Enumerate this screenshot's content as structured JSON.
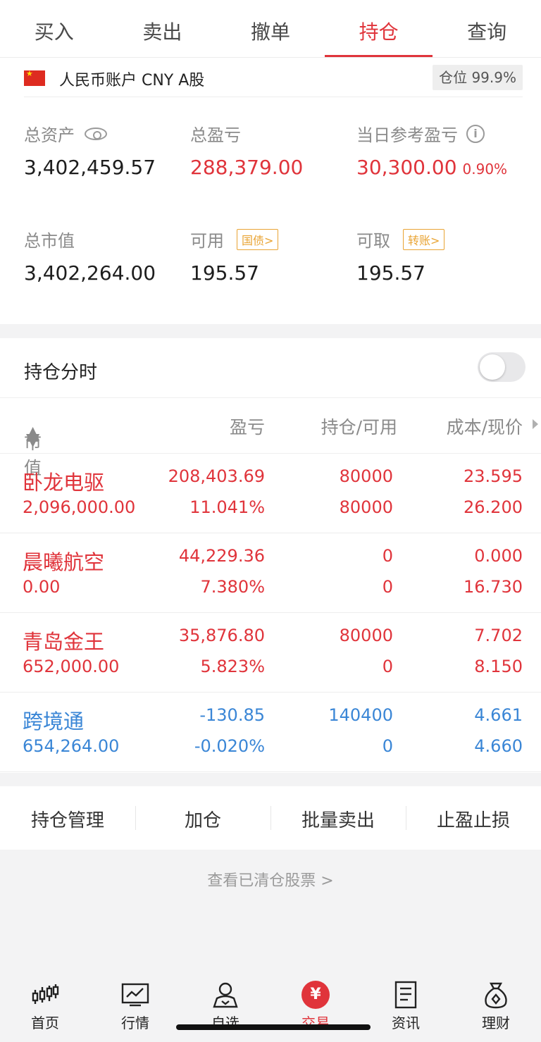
{
  "tabs": [
    "买入",
    "卖出",
    "撤单",
    "持仓",
    "查询"
  ],
  "active_tab": 3,
  "account": {
    "name": "人民币账户 CNY A股",
    "position_ratio": "仓位 99.9%",
    "total_assets_label": "总资产",
    "total_assets": "3,402,459.57",
    "total_pl_label": "总盈亏",
    "total_pl": "288,379.00",
    "day_pl_label": "当日参考盈亏",
    "day_pl": "30,300.00",
    "day_pl_pct": "0.90%",
    "market_value_label": "总市值",
    "market_value": "3,402,264.00",
    "available_label": "可用",
    "available_tag": "国债>",
    "available": "195.57",
    "withdrawable_label": "可取",
    "withdrawable_tag": "转账>",
    "withdrawable": "195.57"
  },
  "holdings": {
    "title": "持仓分时",
    "toggle_on": false,
    "headers": {
      "market_value": "市值",
      "pl": "盈亏",
      "position": "持仓/可用",
      "cost": "成本/现价"
    },
    "rows": [
      {
        "name": "卧龙电驱",
        "market_value": "2,096,000.00",
        "pl": "208,403.69",
        "pl_pct": "11.041%",
        "qty": "80000",
        "available": "80000",
        "cost": "23.595",
        "price": "26.200",
        "color": "#e0343b"
      },
      {
        "name": "晨曦航空",
        "market_value": "0.00",
        "pl": "44,229.36",
        "pl_pct": "7.380%",
        "qty": "0",
        "available": "0",
        "cost": "0.000",
        "price": "16.730",
        "color": "#e0343b"
      },
      {
        "name": "青岛金王",
        "market_value": "652,000.00",
        "pl": "35,876.80",
        "pl_pct": "5.823%",
        "qty": "80000",
        "available": "0",
        "cost": "7.702",
        "price": "8.150",
        "color": "#e0343b"
      },
      {
        "name": "跨境通",
        "market_value": "654,264.00",
        "pl": "-130.85",
        "pl_pct": "-0.020%",
        "qty": "140400",
        "available": "0",
        "cost": "4.661",
        "price": "4.660",
        "color": "#3a86d6"
      }
    ]
  },
  "actions": [
    "持仓管理",
    "加仓",
    "批量卖出",
    "止盈止损"
  ],
  "cleared_link": "查看已清仓股票 >",
  "nav": [
    {
      "label": "首页",
      "icon": "candlestick-icon"
    },
    {
      "label": "行情",
      "icon": "chart-monitor-icon"
    },
    {
      "label": "自选",
      "icon": "person-icon"
    },
    {
      "label": "交易",
      "icon": "yen-icon"
    },
    {
      "label": "资讯",
      "icon": "document-icon"
    },
    {
      "label": "理财",
      "icon": "money-bag-icon"
    }
  ],
  "active_nav": 3
}
